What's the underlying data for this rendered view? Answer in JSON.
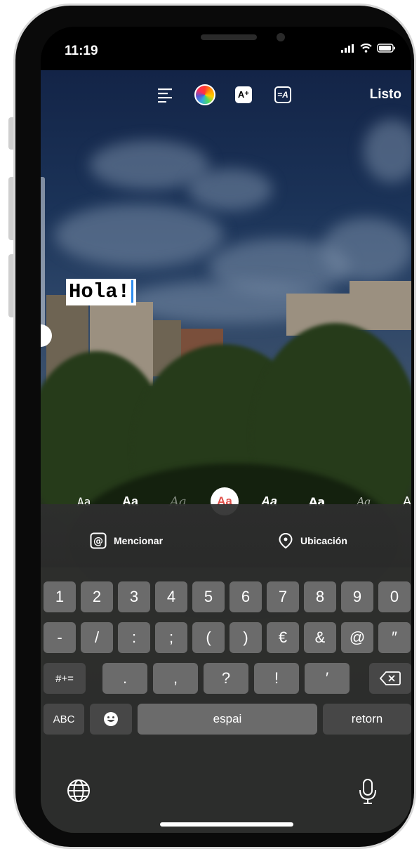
{
  "status_bar": {
    "time": "11:19"
  },
  "toolbar": {
    "align_icon": "align-left-icon",
    "color_icon": "color-wheel-icon",
    "effects_icon": "text-effects-icon",
    "background_icon": "text-background-icon",
    "done_label": "Listo"
  },
  "editor": {
    "text": "Hola!"
  },
  "font_styles": [
    "Aa",
    "Aa",
    "Aa",
    "Aa",
    "Aa",
    "Aa",
    "Aa",
    "A"
  ],
  "actions": {
    "mention_label": "Mencionar",
    "location_label": "Ubicación"
  },
  "keyboard": {
    "row1": [
      "1",
      "2",
      "3",
      "4",
      "5",
      "6",
      "7",
      "8",
      "9",
      "0"
    ],
    "row2": [
      "-",
      "/",
      ":",
      ";",
      "(",
      ")",
      "€",
      "&",
      "@",
      "″"
    ],
    "row3_switch": "#+=",
    "row3": [
      ".",
      ",",
      "?",
      "!",
      "′"
    ],
    "abc_label": "ABC",
    "space_label": "espai",
    "return_label": "retorn"
  },
  "colors": {
    "accent": "#2c8cf0",
    "key": "#6b6b6b",
    "key_fn": "#474747"
  }
}
